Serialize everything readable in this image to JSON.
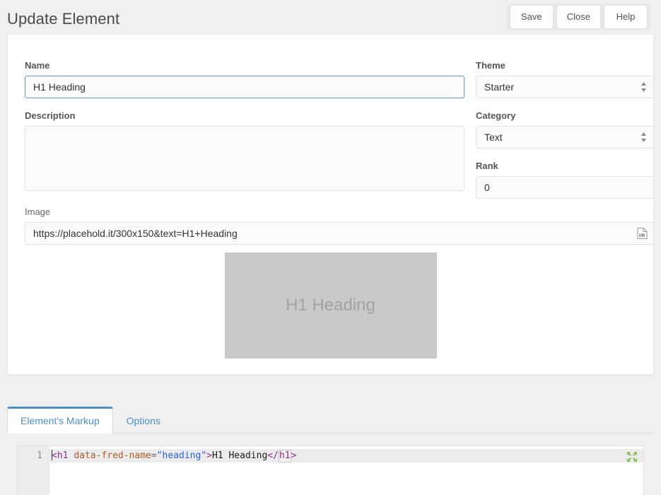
{
  "header": {
    "title": "Update Element",
    "buttons": [
      {
        "label": "Save",
        "name": "save-button"
      },
      {
        "label": "Close",
        "name": "close-button"
      },
      {
        "label": "Help",
        "name": "help-button"
      }
    ]
  },
  "form": {
    "name": {
      "label": "Name",
      "value": "H1 Heading",
      "placeholder": "",
      "focused": true
    },
    "description": {
      "label": "Description",
      "value": "",
      "placeholder": ""
    },
    "theme": {
      "label": "Theme",
      "value": "Starter",
      "options": [
        "Starter"
      ]
    },
    "category": {
      "label": "Category",
      "value": "Text",
      "options": [
        "Text"
      ]
    },
    "rank": {
      "label": "Rank",
      "value": "0",
      "placeholder": ""
    },
    "image": {
      "label": "Image",
      "value": "https://placehold.it/300x150&text=H1+Heading",
      "placeholder": "",
      "icon": "image-file-icon"
    },
    "preview": {
      "text": "H1 Heading",
      "width": "300",
      "height": "150",
      "bg_color": "#c9c9c9",
      "text_color": "#a3a3a3"
    }
  },
  "tabs": [
    {
      "label": "Element's Markup",
      "name": "tab-elements-markup",
      "active": true
    },
    {
      "label": "Options",
      "name": "tab-options",
      "active": false
    }
  ],
  "editor": {
    "line_number": "1",
    "expand_icon": "expand-arrows-icon",
    "tokens": {
      "open_tag": "<h1",
      "space": " ",
      "attr_name": "data-fred-name",
      "equals": "=",
      "attr_value": "\"heading\"",
      "gt": ">",
      "text": "H1 Heading",
      "close_start": "</",
      "close_name": "h1",
      "close_end": ">"
    },
    "full_code": "<h1 data-fred-name=\"heading\">H1 Heading</h1>"
  },
  "colors": {
    "accent": "#4d90c4",
    "focus_border": "#5b9bc4",
    "page_bg": "#f0f0f0",
    "panel_bg": "#ffffff"
  }
}
